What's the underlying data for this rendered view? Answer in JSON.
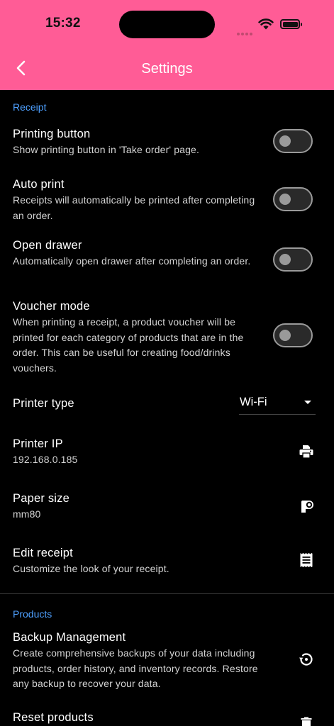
{
  "status_bar": {
    "time": "15:32"
  },
  "app_bar": {
    "title": "Settings"
  },
  "sections": {
    "receipt": {
      "header": "Receipt"
    },
    "products": {
      "header": "Products"
    }
  },
  "receipt": {
    "printing_button": {
      "title": "Printing button",
      "subtitle": "Show printing button in 'Take order' page.",
      "enabled": false
    },
    "auto_print": {
      "title": "Auto print",
      "subtitle": "Receipts will automatically be printed after completing an order.",
      "enabled": false
    },
    "open_drawer": {
      "title": "Open drawer",
      "subtitle": "Automatically open drawer after completing an order.",
      "enabled": false
    },
    "voucher_mode": {
      "title": "Voucher mode",
      "subtitle": "When printing a receipt, a product voucher will be printed for each category of products that are in the order. This can be useful for creating food/drinks vouchers.",
      "enabled": false
    },
    "printer_type": {
      "title": "Printer type",
      "value": "Wi-Fi"
    },
    "printer_ip": {
      "title": "Printer IP",
      "subtitle": "192.168.0.185",
      "icon": "printer-icon"
    },
    "paper_size": {
      "title": "Paper size",
      "subtitle": "mm80",
      "icon": "paper-roll-icon"
    },
    "edit_receipt": {
      "title": "Edit receipt",
      "subtitle": "Customize the look of your receipt.",
      "icon": "receipt-icon"
    }
  },
  "products": {
    "backup": {
      "title": "Backup Management",
      "subtitle": "Create comprehensive backups of your data including products, order history, and inventory records. Restore any backup to recover your data.",
      "icon": "restore-icon"
    },
    "reset": {
      "title": "Reset products",
      "icon": "trash-icon"
    }
  },
  "colors": {
    "accent": "#ff5c96",
    "section_header": "#4ea0ff",
    "background": "#000000"
  }
}
